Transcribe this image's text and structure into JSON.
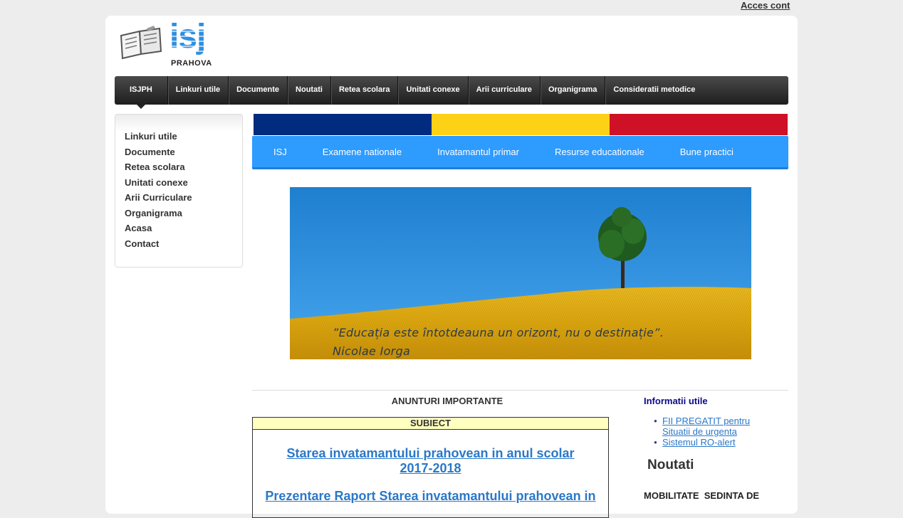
{
  "account_link": "Acces cont",
  "logo": {
    "main": "isj",
    "sub": "PRAHOVA"
  },
  "topnav": [
    "ISJPH",
    "Linkuri utile",
    "Documente",
    "Noutati",
    "Retea scolara",
    "Unitati conexe",
    "Arii curriculare",
    "Organigrama",
    "Consideratii metodice"
  ],
  "sidebar": [
    "Linkuri utile",
    "Documente",
    "Retea scolara",
    "Unitati conexe",
    "Arii Curriculare",
    "Organigrama",
    "Acasa",
    "Contact"
  ],
  "flag_colors": [
    "#002b7f",
    "#fcd116",
    "#ce1126"
  ],
  "bluenav": [
    "ISJ",
    "Examene nationale",
    "Invatamantul primar",
    "Resurse educationale",
    "Bune practici"
  ],
  "banner": {
    "quote_line1": "”Educația este întotdeauna un orizont, nu o destinație”.",
    "quote_line2": "Nicolae Iorga"
  },
  "anunturi": {
    "title": "ANUNTURI IMPORTANTE",
    "header": "SUBIECT",
    "links": [
      "Starea invatamantului prahovean in anul scolar 2017-2018",
      "Prezentare Raport Starea invatamantului prahovean in"
    ]
  },
  "info": {
    "title": "Informatii utile",
    "items": [
      "FII PREGATIT pentru Situatii de urgenta ",
      "Sistemul RO-alert"
    ]
  },
  "noutati": {
    "title": "Noutati",
    "first_item": "MOBILITATE  SEDINTA DE"
  }
}
